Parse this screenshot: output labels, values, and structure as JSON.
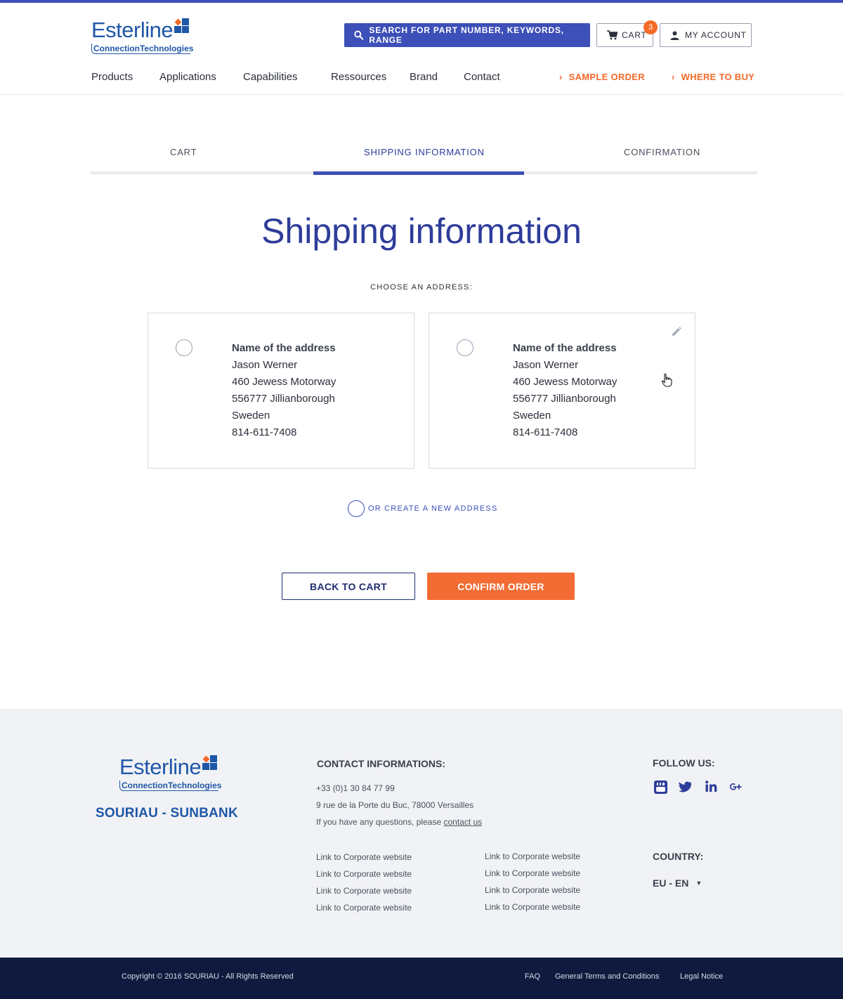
{
  "colors": {
    "accent": "#3d4fb8",
    "orange": "#f46a29",
    "navy": "#101a3f",
    "title": "#2e3c9a"
  },
  "header": {
    "logo": {
      "word": "Esterline",
      "sub": "ConnectionTechnologies"
    },
    "search_label": "SEARCH FOR PART NUMBER, KEYWORDS, RANGE",
    "cart_label": "CART",
    "cart_count": "3",
    "account_label": "MY ACCOUNT"
  },
  "nav": {
    "items": [
      "Products",
      "Applications",
      "Capabilities",
      "Ressources",
      "Brand",
      "Contact"
    ],
    "sample_order": "SAMPLE ORDER",
    "where_to_buy": "WHERE TO BUY"
  },
  "steps": [
    "CART",
    "SHIPPING INFORMATION",
    "CONFIRMATION"
  ],
  "main": {
    "title": "Shipping information",
    "choose_label": "CHOOSE AN ADDRESS:",
    "addresses": [
      {
        "name": "Name of the address",
        "person": "Jason Werner",
        "street": "460 Jewess Motorway",
        "city": "556777 Jillianborough",
        "country": "Sweden",
        "phone": "814-611-7408"
      },
      {
        "name": "Name of the address",
        "person": "Jason Werner",
        "street": "460 Jewess Motorway",
        "city": "556777 Jillianborough",
        "country": "Sweden",
        "phone": "814-611-7408"
      }
    ],
    "new_address_label": "OR CREATE A NEW ADDRESS",
    "back_label": "BACK TO CART",
    "confirm_label": "CONFIRM ORDER"
  },
  "footer": {
    "logo": {
      "word": "Esterline",
      "sub": "ConnectionTechnologies"
    },
    "brand": "SOURIAU - SUNBANK",
    "contact_heading": "CONTACT INFORMATIONS:",
    "phone": "+33 (0)1 30 84 77 99",
    "address": "9 rue de la Porte du Buc, 78000 Versailles",
    "question_text": "If you have any questions, please",
    "contact_link": "contact us",
    "links_col1": [
      "Link to Corporate website",
      "Link to Corporate website",
      "Link to Corporate website",
      "Link to Corporate website"
    ],
    "links_col2": [
      "Link to Corporate website",
      "Link to Corporate website",
      "Link to Corporate website",
      "Link to Corporate website"
    ],
    "follow_heading": "FOLLOW US:",
    "social_icons": [
      "youtube-icon",
      "twitter-icon",
      "linkedin-icon",
      "google-plus-icon"
    ],
    "country_heading": "COUNTRY:",
    "country_value": "EU - EN"
  },
  "bottom": {
    "copyright": "Copyright © 2016 SOURIAU - All Rights Reserved",
    "faq": "FAQ",
    "terms": "General Terms and Conditions",
    "legal": "Legal Notice"
  }
}
